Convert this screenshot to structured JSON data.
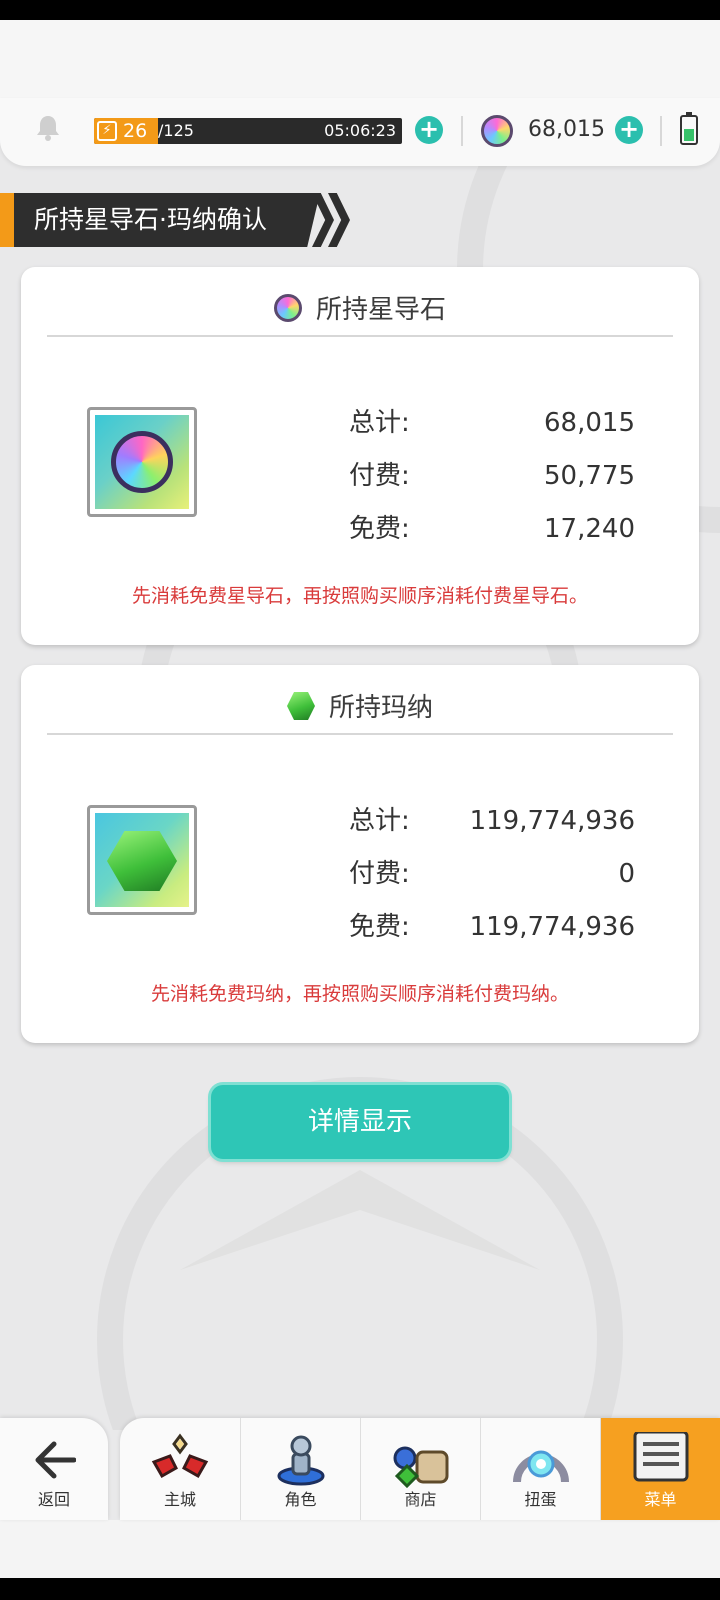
{
  "header": {
    "stamina_current": "26",
    "stamina_max": "/125",
    "stamina_fraction": 0.208,
    "timer": "05:06:23",
    "gem_count": "68,015"
  },
  "page": {
    "title": "所持星导石·玛纳确认"
  },
  "star_stone": {
    "title": "所持星导石",
    "rows": [
      {
        "label": "总计:",
        "value": "68,015"
      },
      {
        "label": "付费:",
        "value": "50,775"
      },
      {
        "label": "免费:",
        "value": "17,240"
      }
    ],
    "note": "先消耗免费星导石，再按照购买顺序消耗付费星导石。"
  },
  "mana": {
    "title": "所持玛纳",
    "rows": [
      {
        "label": "总计:",
        "value": "119,774,936"
      },
      {
        "label": "付费:",
        "value": "0"
      },
      {
        "label": "免费:",
        "value": "119,774,936"
      }
    ],
    "note": "先消耗免费玛纳，再按照购买顺序消耗付费玛纳。"
  },
  "detail_button": "详情显示",
  "nav": {
    "back": "返回",
    "tabs": [
      "主城",
      "角色",
      "商店",
      "扭蛋",
      "菜单"
    ],
    "active_tab": "菜单"
  },
  "colors": {
    "accent_teal": "#2ec6b6",
    "accent_orange": "#f6a020",
    "note_red": "#d93b3b"
  }
}
